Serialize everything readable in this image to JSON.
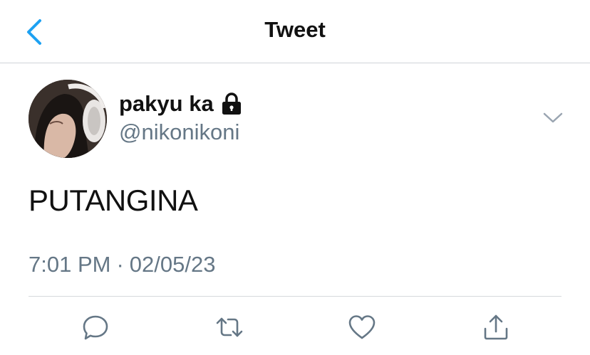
{
  "nav": {
    "title": "Tweet",
    "back_icon": "chevron-left-icon"
  },
  "author": {
    "display_name": "pakyu ka",
    "handle": "@nikonikoni",
    "protected_icon": "lock-icon",
    "avatar_icon": "avatar-photo"
  },
  "tweet": {
    "text": "PUTANGINA",
    "time": "7:01 PM",
    "separator": "·",
    "date": "02/05/23"
  },
  "actions": [
    {
      "name": "reply",
      "icon": "reply-icon"
    },
    {
      "name": "retweet",
      "icon": "retweet-icon"
    },
    {
      "name": "like",
      "icon": "heart-icon"
    },
    {
      "name": "share",
      "icon": "share-icon"
    }
  ],
  "colors": {
    "accent": "#1da1f2",
    "secondary_text": "#657786",
    "icon_gray": "#657786",
    "divider": "#d6d9dc"
  }
}
